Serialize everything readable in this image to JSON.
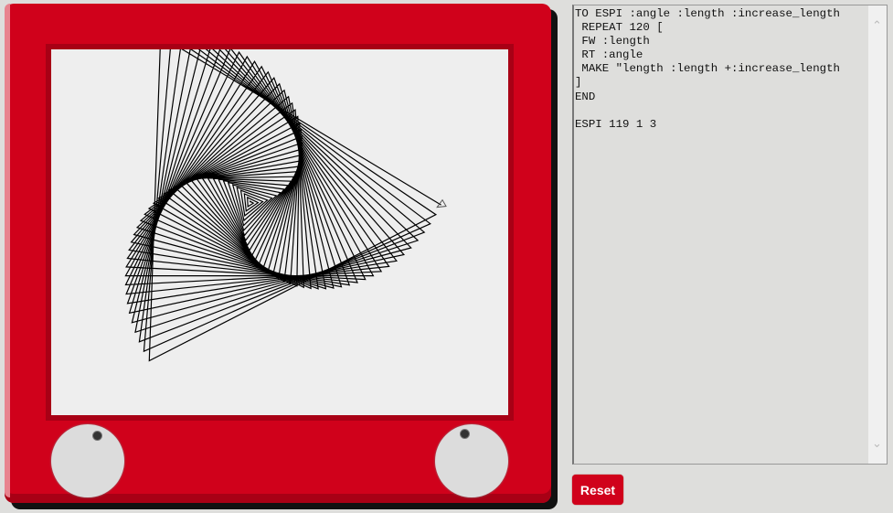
{
  "editor": {
    "lines": [
      "TO ESPI :angle :length :increase_length",
      " REPEAT 120 [",
      " FW :length",
      " RT :angle",
      " MAKE \"length :length +:increase_length",
      "]",
      "END",
      "",
      "ESPI 119 1 3"
    ]
  },
  "drawing": {
    "angle": 119,
    "length": 1,
    "increase_length": 3,
    "repeat": 120,
    "line_color": "#000000"
  },
  "reset_label": "Reset",
  "colors": {
    "frame": "#d0011b",
    "screen": "#eeeeee"
  }
}
